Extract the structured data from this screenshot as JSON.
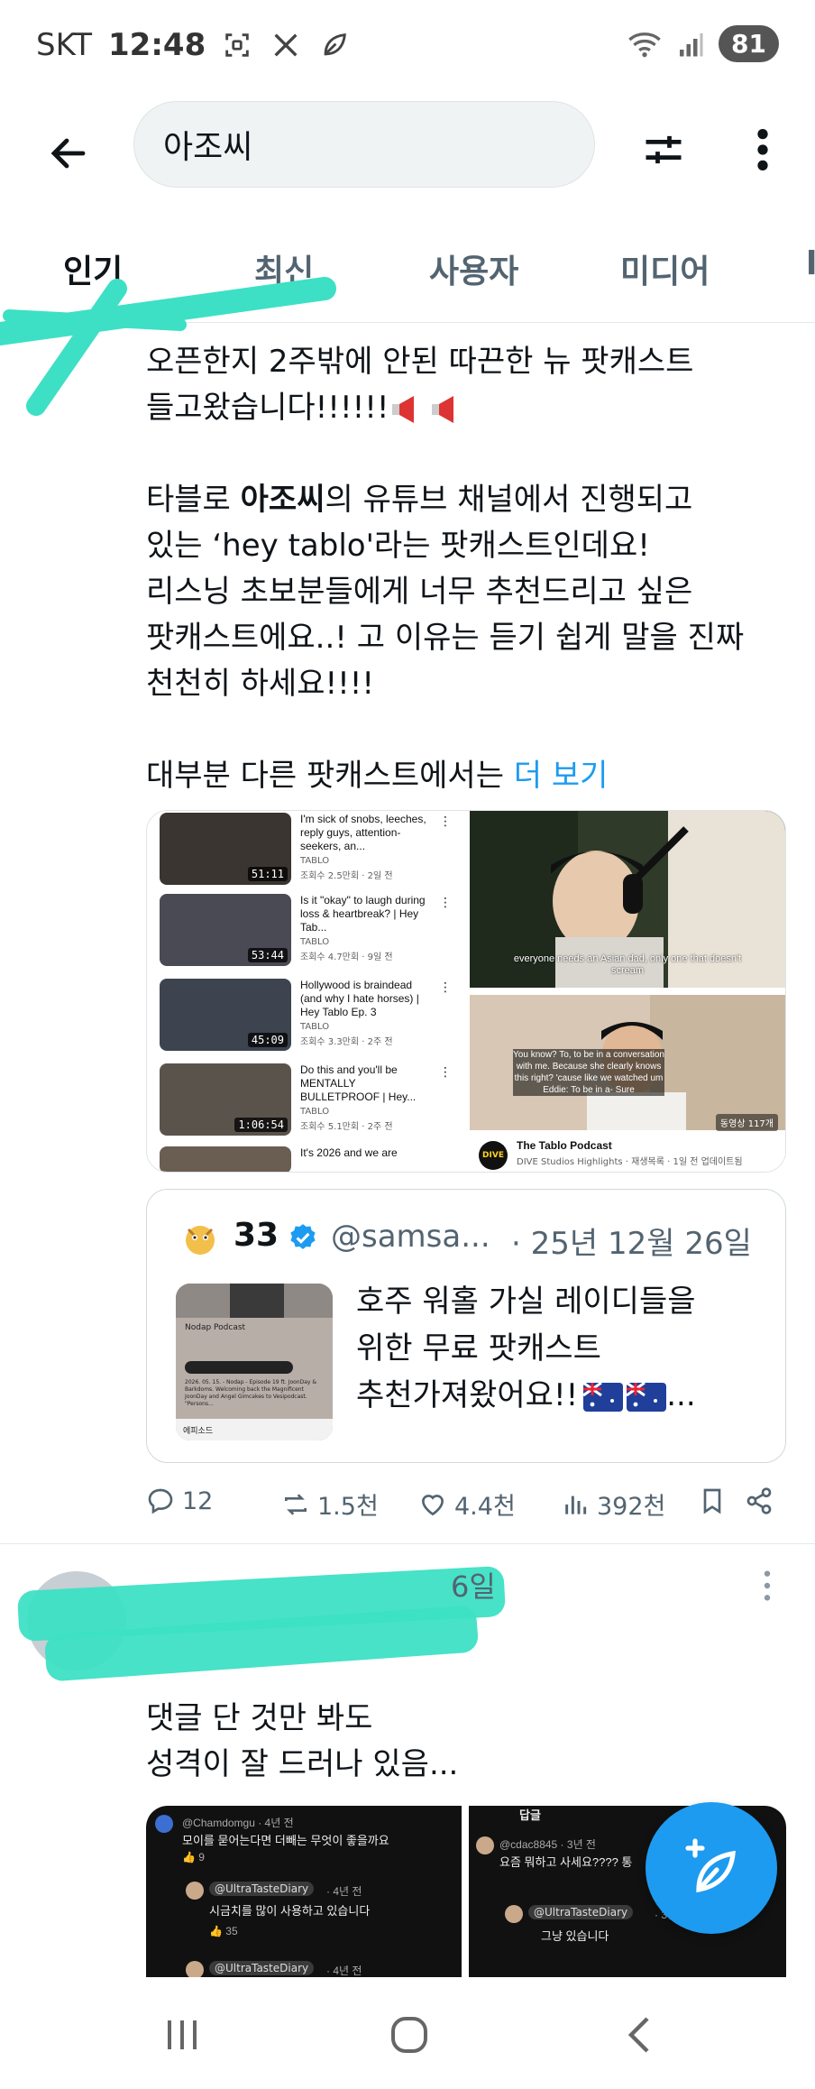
{
  "status_bar": {
    "carrier": "SKT",
    "time": "12:48",
    "battery": "81"
  },
  "search": {
    "query": "아조씨"
  },
  "tabs": [
    {
      "label": "인기",
      "active": true
    },
    {
      "label": "최신",
      "active": false
    },
    {
      "label": "사용자",
      "active": false
    },
    {
      "label": "미디어",
      "active": false
    }
  ],
  "post1": {
    "text_line1": "오픈한지 2주밖에 안된 따끈한 뉴 팟캐스트",
    "text_line2": "들고왔습니다!!!!!!",
    "text_pre_bold": "타블로 ",
    "text_bold": "아조씨",
    "text_after_bold": "의 유튜브 채널에서 진행되고\n있는 ‘hey tablo'라는 팟캐스트인데요!\n리스닝 초보분들에게 너무 추천드리고 싶은\n팟캐스트에요..! 고 이유는 듣기 쉽게 말을 진짜\n천천히 하세요!!!!",
    "text_last": "대부분 다른 팟캐스트에서는 ",
    "more_link": "더 보기",
    "media": {
      "videos": [
        {
          "title": "I'm sick of snobs, leeches, reply guys, attention-seekers, an...",
          "channel": "TABLO",
          "meta": "조회수 2.5만회 · 2일 전",
          "duration": "51:11"
        },
        {
          "title": "Is it \"okay\" to laugh during loss & heartbreak? | Hey Tab...",
          "channel": "TABLO",
          "meta": "조회수 4.7만회 · 9일 전",
          "duration": "53:44"
        },
        {
          "title": "Hollywood is braindead (and why I hate horses) | Hey Tablo Ep. 3",
          "channel": "TABLO",
          "meta": "조회수 3.3만회 · 2주 전",
          "duration": "45:09"
        },
        {
          "title": "Do this and you'll be MENTALLY BULLETPROOF | Hey...",
          "channel": "TABLO",
          "meta": "조회수 5.1만회 · 2주 전",
          "duration": "1:06:54"
        },
        {
          "title": "It's 2026 and we are",
          "channel": "",
          "meta": "",
          "duration": ""
        }
      ],
      "right_top_caption": "everyone needs an Asian dad, only one that doesn't scream",
      "right_bottom_caption": "You know? To, to be in a conversation with me. Because she clearly knows this right? 'cause like we watched um Eddie: To be in a- Sure",
      "right_bottom_views": "동영상 117개",
      "podcast_name": "The Tablo Podcast",
      "podcast_sub": "DIVE Studios Highlights · 재생목록 · 1일 전 업데이트됨",
      "podcast_logo": "DIVE"
    },
    "quote": {
      "name": "33",
      "handle": "@samsa...",
      "date": "· 25년 12월 26일",
      "text": "호주 워홀 가실 레이디들을\n위한 무료 팟캐스트\n추천가져왔어요!!",
      "thumb_title": "Nodap Podcast",
      "thumb_sub": "2026. 05. 15. - Nodap - Episode 19 ft. JoonDay & Barkdoms. Welcoming back the Magnificent JoonDay and Angel Gimcakes to Vesipodcast. \"Persons...",
      "thumb_footer": "에피소드"
    },
    "actions": {
      "replies": "12",
      "reposts": "1.5천",
      "likes": "4.4천",
      "views": "392천"
    }
  },
  "post2": {
    "date": "6일",
    "text": "댓글 단 것만 봐도\n성격이 잘 드러나 있음...",
    "comments_left": {
      "handle1": "@Chamdomgu · 4년 전",
      "text1": "모이를 묻어는다면 더빼는 무엇이 좋을까요",
      "likes1": "9",
      "handle2": "@UltraTasteDiary",
      "time2": "· 4년 전",
      "text2": "시금치를 많이 사용하고 있습니다",
      "likes2": "35",
      "handle3": "@UltraTasteDiary",
      "time3": "· 4년 전"
    },
    "comments_right": {
      "header": "답글",
      "handle1": "@cdac8845 · 3년 전",
      "text1": "요즘 뭐하고 사세요???? 통",
      "handle2": "@UltraTasteDiary",
      "time2": "· 3년 전",
      "text2": "그냥 있습니다"
    }
  },
  "colors": {
    "accent": "#1d9bf0",
    "redaction": "#3de0c4",
    "muted": "#536471"
  }
}
